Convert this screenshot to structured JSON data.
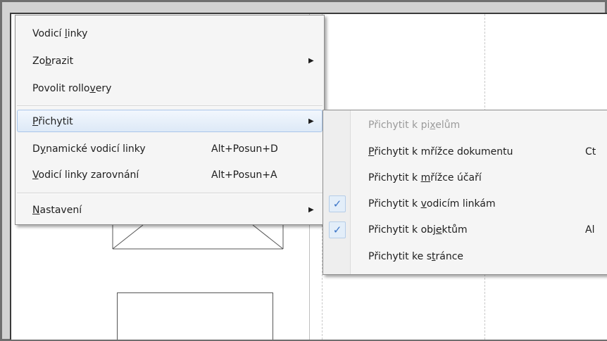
{
  "main_menu": {
    "items": [
      {
        "pre": "Vodicí ",
        "acc": "l",
        "post": "inky"
      },
      {
        "pre": "Zo",
        "acc": "b",
        "post": "razit",
        "arrow": "▶"
      },
      {
        "pre": "Povolit rollo",
        "acc": "v",
        "post": "ery"
      },
      {
        "pre": "",
        "acc": "P",
        "post": "řichytit",
        "arrow": "▶"
      },
      {
        "pre": "D",
        "acc": "y",
        "post": "namické vodicí linky",
        "shortcut": "Alt+Posun+D"
      },
      {
        "pre": "",
        "acc": "V",
        "post": "odicí linky zarovnání",
        "shortcut": "Alt+Posun+A"
      },
      {
        "pre": "",
        "acc": "N",
        "post": "astavení",
        "arrow": "▶"
      }
    ]
  },
  "sub_menu": {
    "items": [
      {
        "pre": "Přichytit k pi",
        "acc": "x",
        "post": "elům",
        "disabled": true
      },
      {
        "pre": "",
        "acc": "P",
        "post": "řichytit k mřížce dokumentu",
        "shortcut": "Ct"
      },
      {
        "pre": "Přichytit k ",
        "acc": "m",
        "post": "řížce účaří"
      },
      {
        "pre": "Přichytit k ",
        "acc": "v",
        "post": "odicím linkám",
        "check": "✓"
      },
      {
        "pre": "Přichytit k obj",
        "acc": "e",
        "post": "ktům",
        "check": "✓",
        "shortcut": "Al"
      },
      {
        "pre": "Přichytit ke s",
        "acc": "t",
        "post": "ránce"
      }
    ]
  }
}
